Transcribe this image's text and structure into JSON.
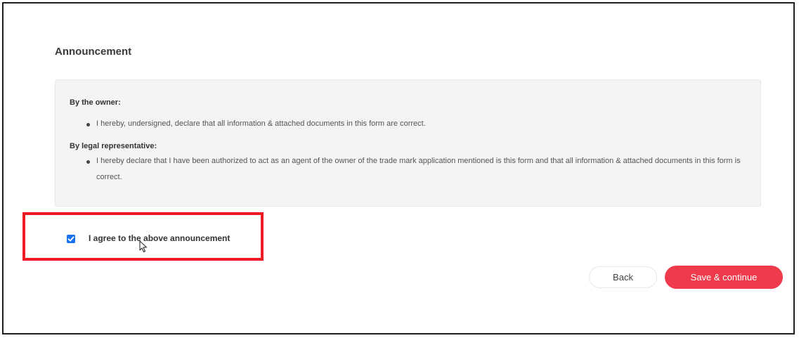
{
  "form": {
    "title": "Announcement",
    "owner_heading": "By the owner:",
    "owner_statement": "I hereby, undersigned, declare that all information & attached documents in this form are correct.",
    "legal_heading": "By legal representative:",
    "legal_statement": "I hereby declare that I have been authorized to act as an agent of the owner of the trade mark application mentioned is this form and that all information & attached documents in this form is correct."
  },
  "agreement": {
    "label": "I agree to the above announcement",
    "checked": true
  },
  "actions": {
    "back_label": "Back",
    "save_label": "Save & continue"
  },
  "colors": {
    "accent_button": "#ee3a4a",
    "checkbox": "#1a73e8",
    "highlight_box": "#ee1b24"
  }
}
